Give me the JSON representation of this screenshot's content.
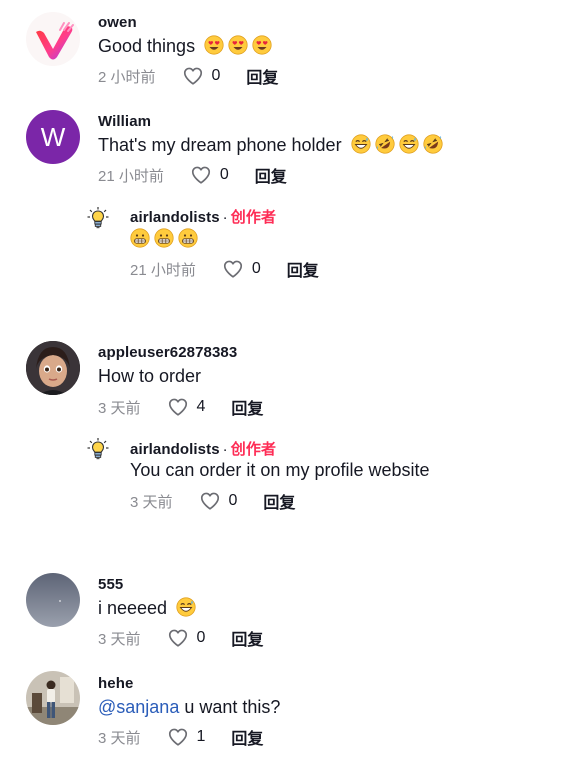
{
  "comments": [
    {
      "username": "owen",
      "text": "Good things",
      "emojis": [
        "smiling-face-with-heart-eyes",
        "smiling-face-with-heart-eyes",
        "smiling-face-with-heart-eyes"
      ],
      "time": "2 小时前",
      "likes": "0",
      "reply_label": "回复"
    },
    {
      "username": "William",
      "avatar_letter": "W",
      "avatar_color": "#7b26a8",
      "text": "That's my dream phone holder",
      "emojis": [
        "grinning-sweat",
        "rofl",
        "grinning-sweat",
        "rofl"
      ],
      "time": "21 小时前",
      "likes": "0",
      "reply_label": "回复",
      "reply": {
        "username": "airlandolists",
        "separator": "·",
        "creator_tag": "创作者",
        "emojis": [
          "grimacing-face",
          "grimacing-face",
          "grimacing-face"
        ],
        "time": "21 小时前",
        "likes": "0",
        "reply_label": "回复"
      }
    },
    {
      "username": "appleuser62878383",
      "text": "How to order",
      "time": "3 天前",
      "likes": "4",
      "reply_label": "回复",
      "reply": {
        "username": "airlandolists",
        "separator": "·",
        "creator_tag": "创作者",
        "text": "You can order it on my profile website",
        "time": "3 天前",
        "likes": "0",
        "reply_label": "回复"
      }
    },
    {
      "username": "555",
      "text": "i neeeed",
      "emojis": [
        "grinning-sweat"
      ],
      "time": "3 天前",
      "likes": "0",
      "reply_label": "回复"
    },
    {
      "username": "hehe",
      "mention": "@sanjana",
      "text": " u want this?",
      "time": "3 天前",
      "likes": "1",
      "reply_label": "回复"
    }
  ],
  "colors": {
    "accent_creator": "#fe2c55",
    "mention": "#2b5db9",
    "meta_gray": "#8a8b91"
  }
}
